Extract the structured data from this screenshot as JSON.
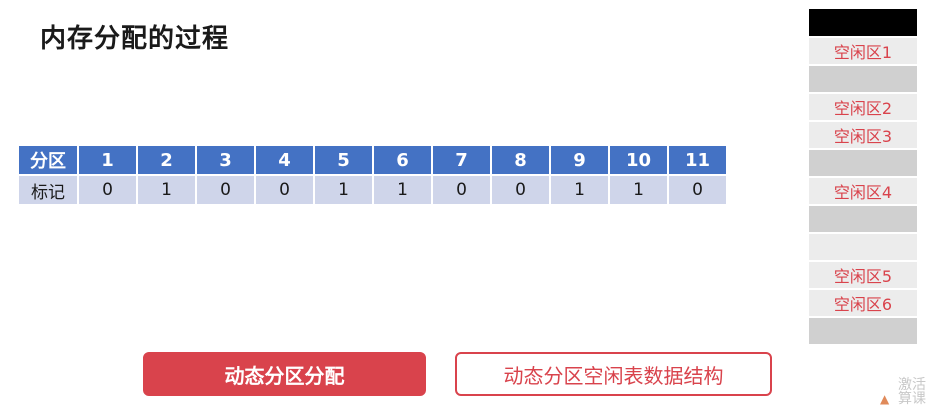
{
  "title": "内存分配的过程",
  "partition_table": {
    "header_label": "分区",
    "row_label": "标记",
    "partitions": [
      "1",
      "2",
      "3",
      "4",
      "5",
      "6",
      "7",
      "8",
      "9",
      "10",
      "11"
    ],
    "marks": [
      "0",
      "1",
      "0",
      "0",
      "1",
      "1",
      "0",
      "0",
      "1",
      "1",
      "0"
    ]
  },
  "memory": {
    "blocks": [
      {
        "type": "os",
        "label": ""
      },
      {
        "type": "free",
        "label": "空闲区1"
      },
      {
        "type": "used",
        "label": ""
      },
      {
        "type": "free",
        "label": "空闲区2"
      },
      {
        "type": "free",
        "label": "空闲区3"
      },
      {
        "type": "used",
        "label": ""
      },
      {
        "type": "free",
        "label": "空闲区4"
      },
      {
        "type": "used",
        "label": ""
      },
      {
        "type": "used",
        "label": ""
      },
      {
        "type": "free",
        "label": "空闲区5"
      },
      {
        "type": "free",
        "label": "空闲区6"
      },
      {
        "type": "used",
        "label": ""
      }
    ],
    "colors": {
      "os": "#000000",
      "used": "#d0d0d0",
      "free_text": "#d9434c"
    }
  },
  "buttons": {
    "primary": "动态分区分配",
    "secondary": "动态分区空闲表数据结构"
  },
  "watermark": {
    "line1": "激活",
    "line2": "算课"
  },
  "colors": {
    "accent": "#d9434c",
    "table_header": "#4472c4",
    "table_body": "#cfd5ea"
  }
}
